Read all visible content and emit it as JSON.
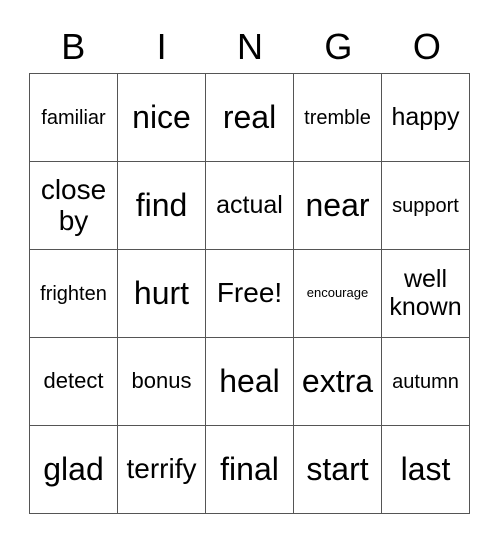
{
  "header": [
    "B",
    "I",
    "N",
    "G",
    "O"
  ],
  "cells": [
    [
      "familiar",
      "nice",
      "real",
      "tremble",
      "happy"
    ],
    [
      "close by",
      "find",
      "actual",
      "near",
      "support"
    ],
    [
      "frighten",
      "hurt",
      "Free!",
      "encourage",
      "well known"
    ],
    [
      "detect",
      "bonus",
      "heal",
      "extra",
      "autumn"
    ],
    [
      "glad",
      "terrify",
      "final",
      "start",
      "last"
    ]
  ]
}
